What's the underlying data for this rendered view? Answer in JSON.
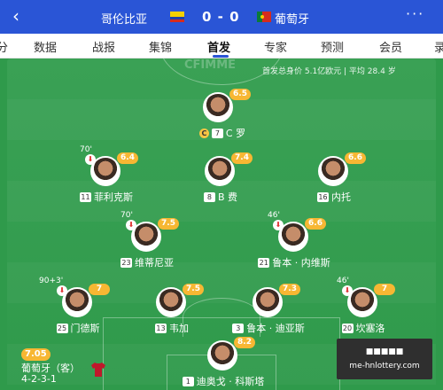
{
  "header": {
    "back_icon": "‹",
    "team_left": "哥伦比亚",
    "score": "0 - 0",
    "team_right": "葡萄牙",
    "more_icon": "···"
  },
  "tabs": [
    "分",
    "数据",
    "战报",
    "集锦",
    "首发",
    "专家",
    "预测",
    "会员",
    "录"
  ],
  "active_tab": "首发",
  "pitch": {
    "watermark": "CFIMME",
    "info": "首发总身价 5.1亿欧元 | 平均 28.4 岁"
  },
  "players": [
    {
      "name": "C 罗",
      "number": "7",
      "rating": "6.5",
      "captain": "C",
      "sub": ""
    },
    {
      "name": "菲利克斯",
      "number": "11",
      "rating": "6.4",
      "sub": "70'"
    },
    {
      "name": "B 费",
      "number": "8",
      "rating": "7.4",
      "sub": ""
    },
    {
      "name": "内托",
      "number": "16",
      "rating": "6.6",
      "sub": ""
    },
    {
      "name": "维蒂尼亚",
      "number": "23",
      "rating": "7.5",
      "sub": "70'"
    },
    {
      "name": "鲁本 · 内维斯",
      "number": "21",
      "rating": "6.6",
      "sub": "46'"
    },
    {
      "name": "门德斯",
      "number": "25",
      "rating": "7",
      "sub": "90+3'"
    },
    {
      "name": "韦加",
      "number": "13",
      "rating": "7.5",
      "sub": ""
    },
    {
      "name": "鲁本 · 迪亚斯",
      "number": "3",
      "rating": "7.3",
      "sub": ""
    },
    {
      "name": "坎塞洛",
      "number": "20",
      "rating": "7",
      "sub": "46'"
    },
    {
      "name": "迪奥戈 · 科斯塔",
      "number": "1",
      "rating": "8.2",
      "sub": ""
    }
  ],
  "team_box": {
    "rating": "7.05",
    "name": "葡萄牙（客）",
    "formation": "4-2-3-1"
  },
  "ad": {
    "line1": "■■■■■",
    "line2": "me-hnlottery.com"
  },
  "colors": {
    "header": "#2a55d6",
    "pitch": "#2f9a4b",
    "rating": "#f7b733"
  }
}
